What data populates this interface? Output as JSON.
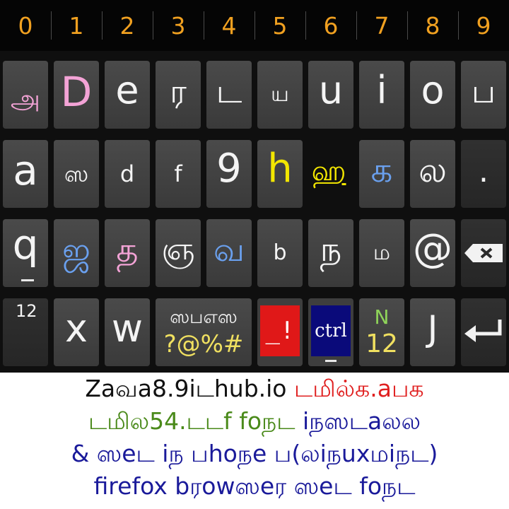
{
  "keyboard": {
    "number_row": [
      "0",
      "1",
      "2",
      "3",
      "4",
      "5",
      "6",
      "7",
      "8",
      "9"
    ],
    "row1": [
      {
        "label": "அ",
        "color": "pink"
      },
      {
        "label": "D",
        "color": "pink"
      },
      {
        "label": "e",
        "color": "white"
      },
      {
        "label": "ர",
        "color": "white"
      },
      {
        "label": "ட",
        "color": "white"
      },
      {
        "label": "ய",
        "color": "white"
      },
      {
        "label": "u",
        "color": "white"
      },
      {
        "label": "i",
        "color": "white"
      },
      {
        "label": "o",
        "color": "white"
      },
      {
        "label": "ப",
        "color": "white"
      }
    ],
    "row2": [
      {
        "label": "a",
        "color": "white"
      },
      {
        "label": "ஸ",
        "color": "white"
      },
      {
        "label": "d",
        "color": "white"
      },
      {
        "label": "f",
        "color": "white"
      },
      {
        "label": "9",
        "color": "white"
      },
      {
        "label": "h",
        "color": "yellow"
      },
      {
        "label": "ஹ",
        "color": "yellow"
      },
      {
        "label": "க",
        "color": "blue"
      },
      {
        "label": "ல",
        "color": "white"
      },
      {
        "label": ".",
        "color": "white"
      }
    ],
    "row3": [
      {
        "label": "q",
        "color": "white"
      },
      {
        "label": "ஜ",
        "color": "blue"
      },
      {
        "label": "த",
        "color": "pink"
      },
      {
        "label": "ஞ",
        "color": "white"
      },
      {
        "label": "வ",
        "color": "blue"
      },
      {
        "label": "b",
        "color": "white"
      },
      {
        "label": "ந",
        "color": "white"
      },
      {
        "label": "ம",
        "color": "white"
      },
      {
        "label": "@",
        "color": "white"
      },
      {
        "label": "backspace",
        "color": "white"
      }
    ],
    "row4": {
      "num_key": "12",
      "x_key": "x",
      "w_key": "w",
      "space_top": "ஸபஎஸ",
      "space_bottom": "?@%#",
      "cursor_key": "_!",
      "ctrl_key": "ctrl",
      "n_top": "N",
      "n_bottom": "12",
      "j_key": "J",
      "enter_icon": "enter"
    }
  },
  "caption": {
    "line1_a": "Zaவa8.9iடhub.io",
    "line1_b": "டமில்க.aபக",
    "line2_a": "டமில54.டடf foநட",
    "line2_b": "iநஸடaலல",
    "line3": "& ஸeட iந பhoநe ப(லiநuxமiநட)",
    "line4": "firefox bரowஸeர ஸeட foநட"
  },
  "colors": {
    "number": "#f0a020",
    "pink": "#f3a3d6",
    "blue": "#6aa0ee",
    "yellow": "#f2e600",
    "red_key": "#e01818",
    "ctrl_key": "#0a0a7a",
    "caption_red": "#e02020",
    "caption_green": "#4a8a1a",
    "caption_navy": "#1a1a9a"
  }
}
